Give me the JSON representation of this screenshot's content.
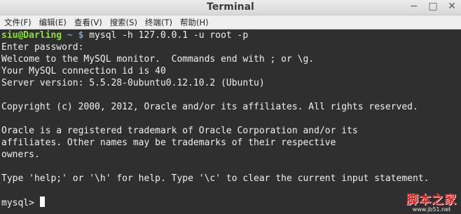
{
  "window": {
    "title": "Terminal",
    "controls": {
      "minimize": "−",
      "maximize": "□",
      "close": "✕"
    }
  },
  "menubar": {
    "items": [
      "文件(F)",
      "编辑(E)",
      "查看(V)",
      "搜索(S)",
      "终端(T)",
      "帮助(H)"
    ]
  },
  "terminal": {
    "prompt_user": "siu@Darling",
    "prompt_path": " ~ $",
    "command": " mysql -h 127.0.0.1 -u root -p",
    "lines": [
      "Enter password:",
      "Welcome to the MySQL monitor.  Commands end with ; or \\g.",
      "Your MySQL connection id is 40",
      "Server version: 5.5.28-0ubuntu0.12.10.2 (Ubuntu)",
      "",
      "Copyright (c) 2000, 2012, Oracle and/or its affiliates. All rights reserved.",
      "",
      "Oracle is a registered trademark of Oracle Corporation and/or its",
      "affiliates. Other names may be trademarks of their respective",
      "owners.",
      "",
      "Type 'help;' or '\\h' for help. Type '\\c' to clear the current input statement.",
      ""
    ],
    "mysql_prompt": "mysql> "
  },
  "watermark": {
    "main": "脚本之家",
    "url": "www.jb51.net"
  },
  "colors": {
    "terminal_bg": "#2f2f2f",
    "terminal_fg": "#f0f0f0",
    "prompt_user": "#8ae234",
    "prompt_path": "#729fcf"
  }
}
